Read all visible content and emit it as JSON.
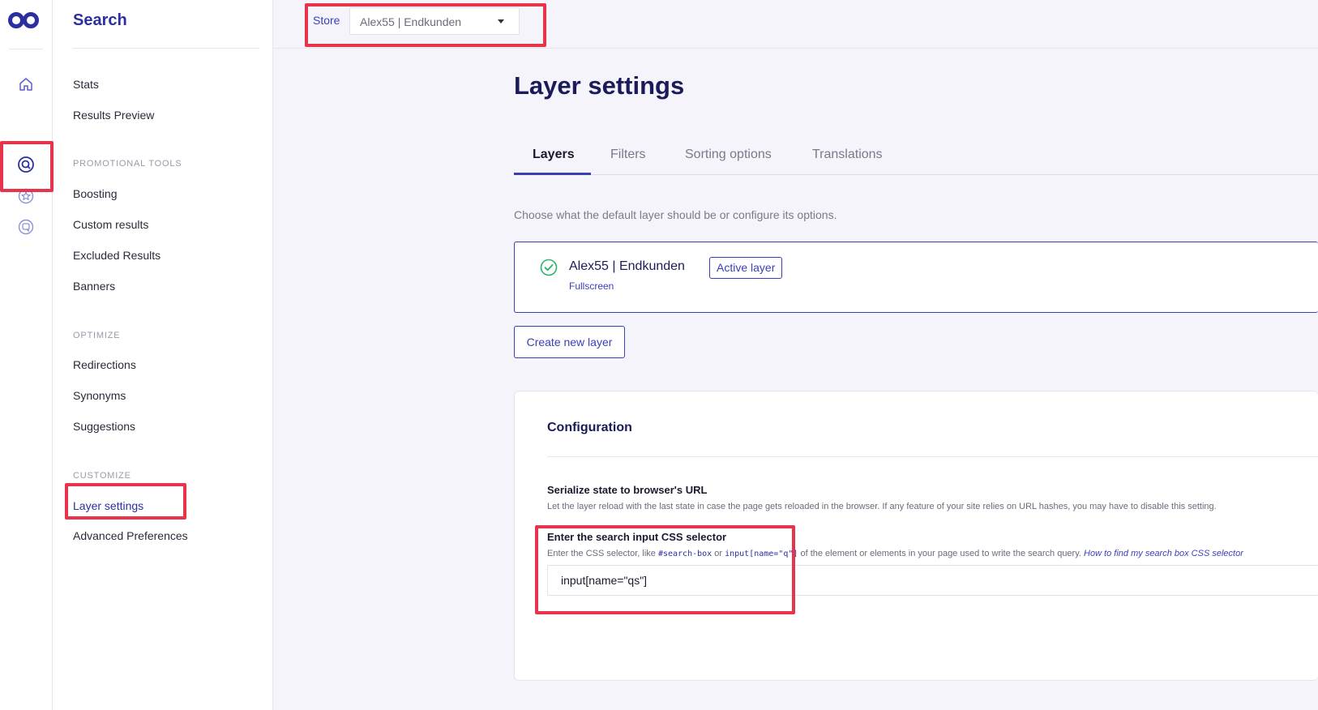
{
  "colors": {
    "accent": "#3a3fb8",
    "highlight": "#e8344a",
    "success": "#2bb36a"
  },
  "rail": {
    "icons": [
      "logo-icon",
      "home-icon",
      "search-icon",
      "star-icon",
      "chat-icon"
    ]
  },
  "sidebar": {
    "title": "Search",
    "items_top": [
      "Stats",
      "Results Preview"
    ],
    "section_promo": "PROMOTIONAL TOOLS",
    "items_promo": [
      "Boosting",
      "Custom results",
      "Excluded Results",
      "Banners"
    ],
    "section_optimize": "OPTIMIZE",
    "items_optimize": [
      "Redirections",
      "Synonyms",
      "Suggestions"
    ],
    "section_customize": "CUSTOMIZE",
    "items_customize": [
      "Layer settings",
      "Advanced Preferences"
    ]
  },
  "topbar": {
    "store_label": "Store",
    "store_value": "Alex55 | Endkunden"
  },
  "main": {
    "title": "Layer settings",
    "tabs": [
      "Layers",
      "Filters",
      "Sorting options",
      "Translations"
    ],
    "intro": "Choose what the default layer should be or configure its options.",
    "layer": {
      "name": "Alex55 | Endkunden",
      "type": "Fullscreen",
      "badge": "Active layer"
    },
    "create_button": "Create new layer",
    "config": {
      "title": "Configuration",
      "serialize_title": "Serialize state to browser's URL",
      "serialize_desc": "Let the layer reload with the last state in case the page gets reloaded in the browser. If any feature of your site relies on URL hashes, you may have to disable this setting.",
      "selector_title": "Enter the search input CSS selector",
      "selector_desc_1": "Enter the CSS selector, like ",
      "selector_code_1": "#search-box",
      "selector_desc_2": " or ",
      "selector_code_2": "input[name=\"q\"]",
      "selector_desc_3": " of the element or elements in your page used to write the search query. ",
      "selector_help": "How to find my search box CSS selector",
      "selector_value": "input[name=\"qs\"]"
    }
  }
}
